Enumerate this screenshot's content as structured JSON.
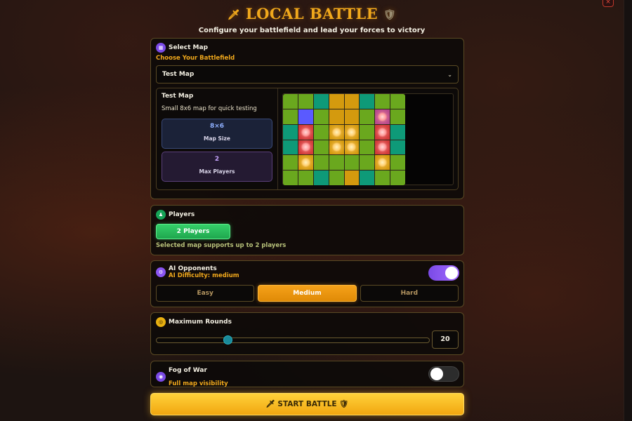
{
  "header": {
    "title": "LOCAL BATTLE",
    "title_left_icon": "sword-icon",
    "title_right_icon": "shield-icon",
    "subtitle": "Configure your battlefield and lead your forces to victory",
    "close_label": "×"
  },
  "map_section": {
    "label": "Select Map",
    "choose_label": "Choose Your Battlefield",
    "selected_map": "Test Map",
    "card": {
      "name": "Test Map",
      "description": "Small 8x6 map for quick testing",
      "size_value": "8×6",
      "size_label": "Map Size",
      "players_value": "2",
      "players_label": "Max Players"
    },
    "preview_rows": [
      [
        "grass",
        "grass",
        "teal",
        "sand",
        "sand",
        "teal",
        "grass",
        "grass"
      ],
      [
        "grass",
        "water",
        "grass",
        "sand",
        "sand",
        "grass",
        "spawnr",
        "grass"
      ],
      [
        "teal",
        "redc",
        "grass",
        "sand",
        "sand",
        "grass",
        "redc",
        "teal"
      ],
      [
        "teal",
        "redc",
        "grass",
        "sand",
        "sand",
        "grass",
        "redc",
        "teal"
      ],
      [
        "grass",
        "sand",
        "grass",
        "grass",
        "grass",
        "grass",
        "sand",
        "grass"
      ],
      [
        "grass",
        "grass",
        "teal",
        "grass",
        "sand",
        "teal",
        "grass",
        "grass"
      ]
    ]
  },
  "players_section": {
    "label": "Players",
    "button": "2 Players",
    "note": "Selected map supports up to 2 players"
  },
  "ai_section": {
    "label": "AI Opponents",
    "difficulty_text": "AI Difficulty: medium",
    "enabled": true,
    "options": [
      "Easy",
      "Medium",
      "Hard"
    ],
    "selected": "Medium"
  },
  "rounds_section": {
    "label": "Maximum Rounds",
    "value": "20",
    "slider_fraction": 0.26
  },
  "fog_section": {
    "label": "Fog of War",
    "description": "Full map visibility",
    "enabled": false
  },
  "start_button": "START BATTLE",
  "colors": {
    "accent": "#f0a81c",
    "players_green": "#2cc35e",
    "ai_purple": "#8a55f2",
    "start_gold": "#f7bf22"
  }
}
